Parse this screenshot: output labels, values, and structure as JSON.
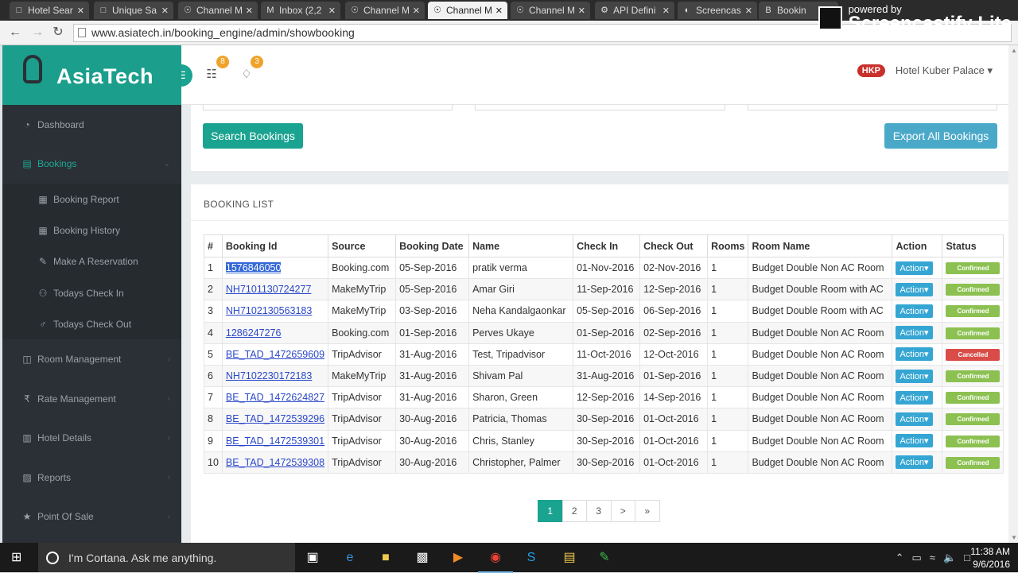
{
  "browser": {
    "tabs": [
      {
        "label": "Hotel Sear",
        "icon": "doc-icon"
      },
      {
        "label": "Unique Sa",
        "icon": "doc-icon"
      },
      {
        "label": "Channel M",
        "icon": "bulb-icon"
      },
      {
        "label": "Inbox (2,2",
        "icon": "gmail-icon"
      },
      {
        "label": "Channel M",
        "icon": "bulb-icon"
      },
      {
        "label": "Channel M",
        "icon": "bulb-icon",
        "active": true
      },
      {
        "label": "Channel M",
        "icon": "bulb-icon"
      },
      {
        "label": "API Defini",
        "icon": "api-icon"
      },
      {
        "label": "Screencas",
        "icon": "screencast-icon"
      },
      {
        "label": "Bookin",
        "icon": "booking-icon"
      }
    ],
    "url": "www.asiatech.in/booking_engine/admin/showbooking",
    "overlay": {
      "small": "powered by",
      "big": "Screencastify Lite"
    }
  },
  "brand": {
    "name": "AsiaTech"
  },
  "topbar": {
    "org_badge_count": "8",
    "notif_badge_count": "3",
    "hotel_code": "HKP",
    "hotel_name": "Hotel Kuber Palace"
  },
  "sidebar": {
    "items": [
      {
        "label": "Dashboard",
        "icon": "dashboard-icon"
      },
      {
        "label": "Bookings",
        "icon": "book-icon",
        "active": true
      },
      {
        "label": "Booking Report",
        "icon": "calendar-icon",
        "sub": true
      },
      {
        "label": "Booking History",
        "icon": "calendar-icon",
        "sub": true
      },
      {
        "label": "Make A Reservation",
        "icon": "edit-icon",
        "sub": true
      },
      {
        "label": "Todays Check In",
        "icon": "users-icon",
        "sub": true
      },
      {
        "label": "Todays Check Out",
        "icon": "user-icon",
        "sub": true
      },
      {
        "label": "Room Management",
        "icon": "columns-icon"
      },
      {
        "label": "Rate Management",
        "icon": "rupee-icon"
      },
      {
        "label": "Hotel Details",
        "icon": "building-icon"
      },
      {
        "label": "Reports",
        "icon": "chart-icon"
      },
      {
        "label": "Point Of Sale",
        "icon": "star-icon"
      }
    ]
  },
  "filters": {
    "search_label": "Search Bookings",
    "export_label": "Export All Bookings"
  },
  "booking_list": {
    "title": "BOOKING LIST",
    "columns": [
      "#",
      "Booking Id",
      "Source",
      "Booking Date",
      "Name",
      "Check In",
      "Check Out",
      "Rooms",
      "Room Name",
      "Action",
      "Status"
    ],
    "rows": [
      {
        "n": "1",
        "id": "1576846050",
        "source": "Booking.com",
        "date": "05-Sep-2016",
        "name": "pratik verma",
        "in": "01-Nov-2016",
        "out": "02-Nov-2016",
        "rooms": "1",
        "room": "Budget Double Non AC Room",
        "status": "Confirmed"
      },
      {
        "n": "2",
        "id": "NH7101130724277",
        "source": "MakeMyTrip",
        "date": "05-Sep-2016",
        "name": "Amar Giri",
        "in": "11-Sep-2016",
        "out": "12-Sep-2016",
        "rooms": "1",
        "room": "Budget Double Room with AC",
        "status": "Confirmed"
      },
      {
        "n": "3",
        "id": "NH7102130563183",
        "source": "MakeMyTrip",
        "date": "03-Sep-2016",
        "name": "Neha Kandalgaonkar",
        "in": "05-Sep-2016",
        "out": "06-Sep-2016",
        "rooms": "1",
        "room": "Budget Double Room with AC",
        "status": "Confirmed"
      },
      {
        "n": "4",
        "id": "1286247276",
        "source": "Booking.com",
        "date": "01-Sep-2016",
        "name": "Perves Ukaye",
        "in": "01-Sep-2016",
        "out": "02-Sep-2016",
        "rooms": "1",
        "room": "Budget Double Non AC Room",
        "status": "Confirmed"
      },
      {
        "n": "5",
        "id": "BE_TAD_1472659609",
        "source": "TripAdvisor",
        "date": "31-Aug-2016",
        "name": "Test, Tripadvisor",
        "in": "11-Oct-2016",
        "out": "12-Oct-2016",
        "rooms": "1",
        "room": "Budget Double Non AC Room",
        "status": "Cancelled"
      },
      {
        "n": "6",
        "id": "NH7102230172183",
        "source": "MakeMyTrip",
        "date": "31-Aug-2016",
        "name": "Shivam Pal",
        "in": "31-Aug-2016",
        "out": "01-Sep-2016",
        "rooms": "1",
        "room": "Budget Double Non AC Room",
        "status": "Confirmed"
      },
      {
        "n": "7",
        "id": "BE_TAD_1472624827",
        "source": "TripAdvisor",
        "date": "31-Aug-2016",
        "name": "Sharon, Green",
        "in": "12-Sep-2016",
        "out": "14-Sep-2016",
        "rooms": "1",
        "room": "Budget Double Non AC Room",
        "status": "Confirmed"
      },
      {
        "n": "8",
        "id": "BE_TAD_1472539296",
        "source": "TripAdvisor",
        "date": "30-Aug-2016",
        "name": "Patricia, Thomas",
        "in": "30-Sep-2016",
        "out": "01-Oct-2016",
        "rooms": "1",
        "room": "Budget Double Non AC Room",
        "status": "Confirmed"
      },
      {
        "n": "9",
        "id": "BE_TAD_1472539301",
        "source": "TripAdvisor",
        "date": "30-Aug-2016",
        "name": "Chris, Stanley",
        "in": "30-Sep-2016",
        "out": "01-Oct-2016",
        "rooms": "1",
        "room": "Budget Double Non AC Room",
        "status": "Confirmed"
      },
      {
        "n": "10",
        "id": "BE_TAD_1472539308",
        "source": "TripAdvisor",
        "date": "30-Aug-2016",
        "name": "Christopher, Palmer",
        "in": "30-Sep-2016",
        "out": "01-Oct-2016",
        "rooms": "1",
        "room": "Budget Double Non AC Room",
        "status": "Confirmed"
      }
    ],
    "action_label": "Action"
  },
  "pagination": {
    "pages": [
      "1",
      "2",
      "3",
      ">",
      "»"
    ],
    "current": "1"
  },
  "taskbar": {
    "cortana_text": "I'm Cortana. Ask me anything.",
    "time": "11:38 AM",
    "date": "9/6/2016"
  },
  "colors": {
    "accent": "#1aa390",
    "sidebar": "#2a3035",
    "confirmed": "#8cc152",
    "cancelled": "#d94c47",
    "action": "#35a6d3"
  }
}
